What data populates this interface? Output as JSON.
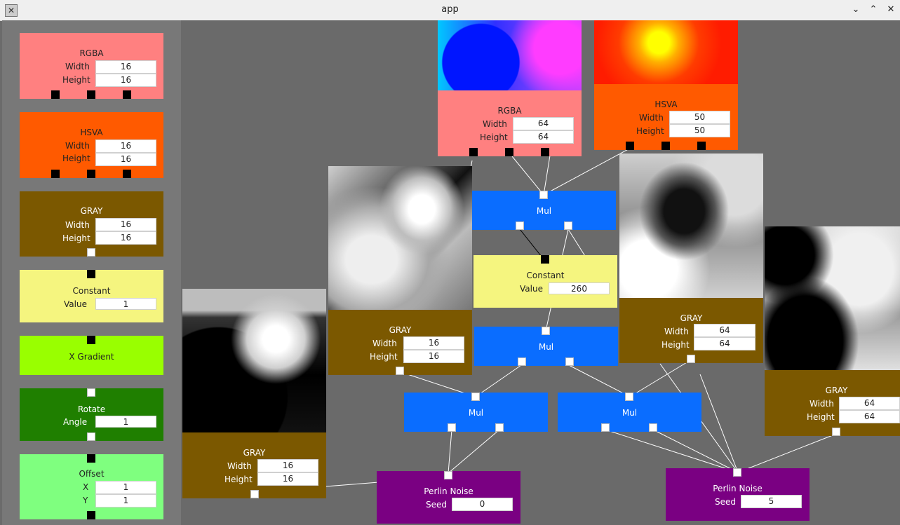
{
  "window": {
    "title": "app"
  },
  "palette": {
    "rgba": {
      "title": "RGBA",
      "width_label": "Width",
      "width": "16",
      "height_label": "Height",
      "height": "16"
    },
    "hsva": {
      "title": "HSVA",
      "width_label": "Width",
      "width": "16",
      "height_label": "Height",
      "height": "16"
    },
    "gray": {
      "title": "GRAY",
      "width_label": "Width",
      "width": "16",
      "height_label": "Height",
      "height": "16"
    },
    "constant": {
      "title": "Constant",
      "value_label": "Value",
      "value": "1"
    },
    "xgradient": {
      "title": "X Gradient"
    },
    "rotate": {
      "title": "Rotate",
      "angle_label": "Angle",
      "angle": "1"
    },
    "offset": {
      "title": "Offset",
      "x_label": "X",
      "x": "1",
      "y_label": "Y",
      "y": "1"
    }
  },
  "canvas": {
    "rgba": {
      "title": "RGBA",
      "width_label": "Width",
      "width": "64",
      "height_label": "Height",
      "height": "64"
    },
    "hsva": {
      "title": "HSVA",
      "width_label": "Width",
      "width": "50",
      "height_label": "Height",
      "height": "50"
    },
    "gray_mid": {
      "title": "GRAY",
      "width_label": "Width",
      "width": "16",
      "height_label": "Height",
      "height": "16"
    },
    "gray_left": {
      "title": "GRAY",
      "width_label": "Width",
      "width": "16",
      "height_label": "Height",
      "height": "16"
    },
    "gray_right": {
      "title": "GRAY",
      "width_label": "Width",
      "width": "64",
      "height_label": "Height",
      "height": "64"
    },
    "gray_far": {
      "title": "GRAY",
      "width_label": "Width",
      "width": "64",
      "height_label": "Height",
      "height": "64"
    },
    "mul1": {
      "title": "Mul"
    },
    "mul2": {
      "title": "Mul"
    },
    "mul3": {
      "title": "Mul"
    },
    "mul4": {
      "title": "Mul"
    },
    "constant": {
      "title": "Constant",
      "value_label": "Value",
      "value": "260"
    },
    "perlin1": {
      "title": "Perlin Noise",
      "seed_label": "Seed",
      "seed": "0"
    },
    "perlin2": {
      "title": "Perlin Noise",
      "seed_label": "Seed",
      "seed": "5"
    }
  },
  "colors": {
    "rgba": "#ff8080",
    "hsva": "#ff5a00",
    "gray": "#7b5800",
    "constant": "#f5f57f",
    "xgradient": "#99ff00",
    "rotate": "#1f7f00",
    "offset": "#7fff7f",
    "mul": "#0a6dff",
    "perlin": "#7a0082"
  }
}
